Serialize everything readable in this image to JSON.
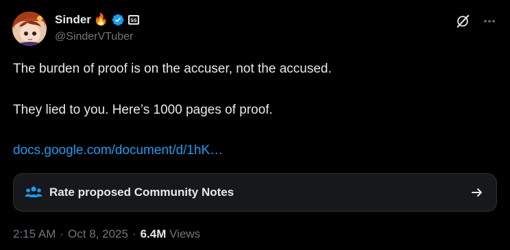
{
  "author": {
    "display_name": "Sinder",
    "handle": "@SinderVTuber",
    "flair_emoji": "🔥"
  },
  "tweet": {
    "line1": "The burden of proof is on the accuser, not the accused.",
    "line2": "They lied to you. Here’s 1000 pages of proof.",
    "link_text": "docs.google.com/document/d/1hK…"
  },
  "community_notes": {
    "label": "Rate proposed Community Notes"
  },
  "meta": {
    "time": "2:15 AM",
    "separator": "·",
    "date": "Oct 8, 2025",
    "separator2": "·",
    "views_count": "6.4M",
    "views_label": "Views"
  },
  "colors": {
    "background": "#000000",
    "text": "#e7e9ea",
    "muted": "#71767b",
    "accent": "#1d9bf0",
    "card": "#16181c"
  },
  "icons": [
    "verified-badge-icon",
    "subscriber-badge-icon",
    "grok-icon",
    "more-icon",
    "community-notes-icon",
    "arrow-right-icon"
  ]
}
